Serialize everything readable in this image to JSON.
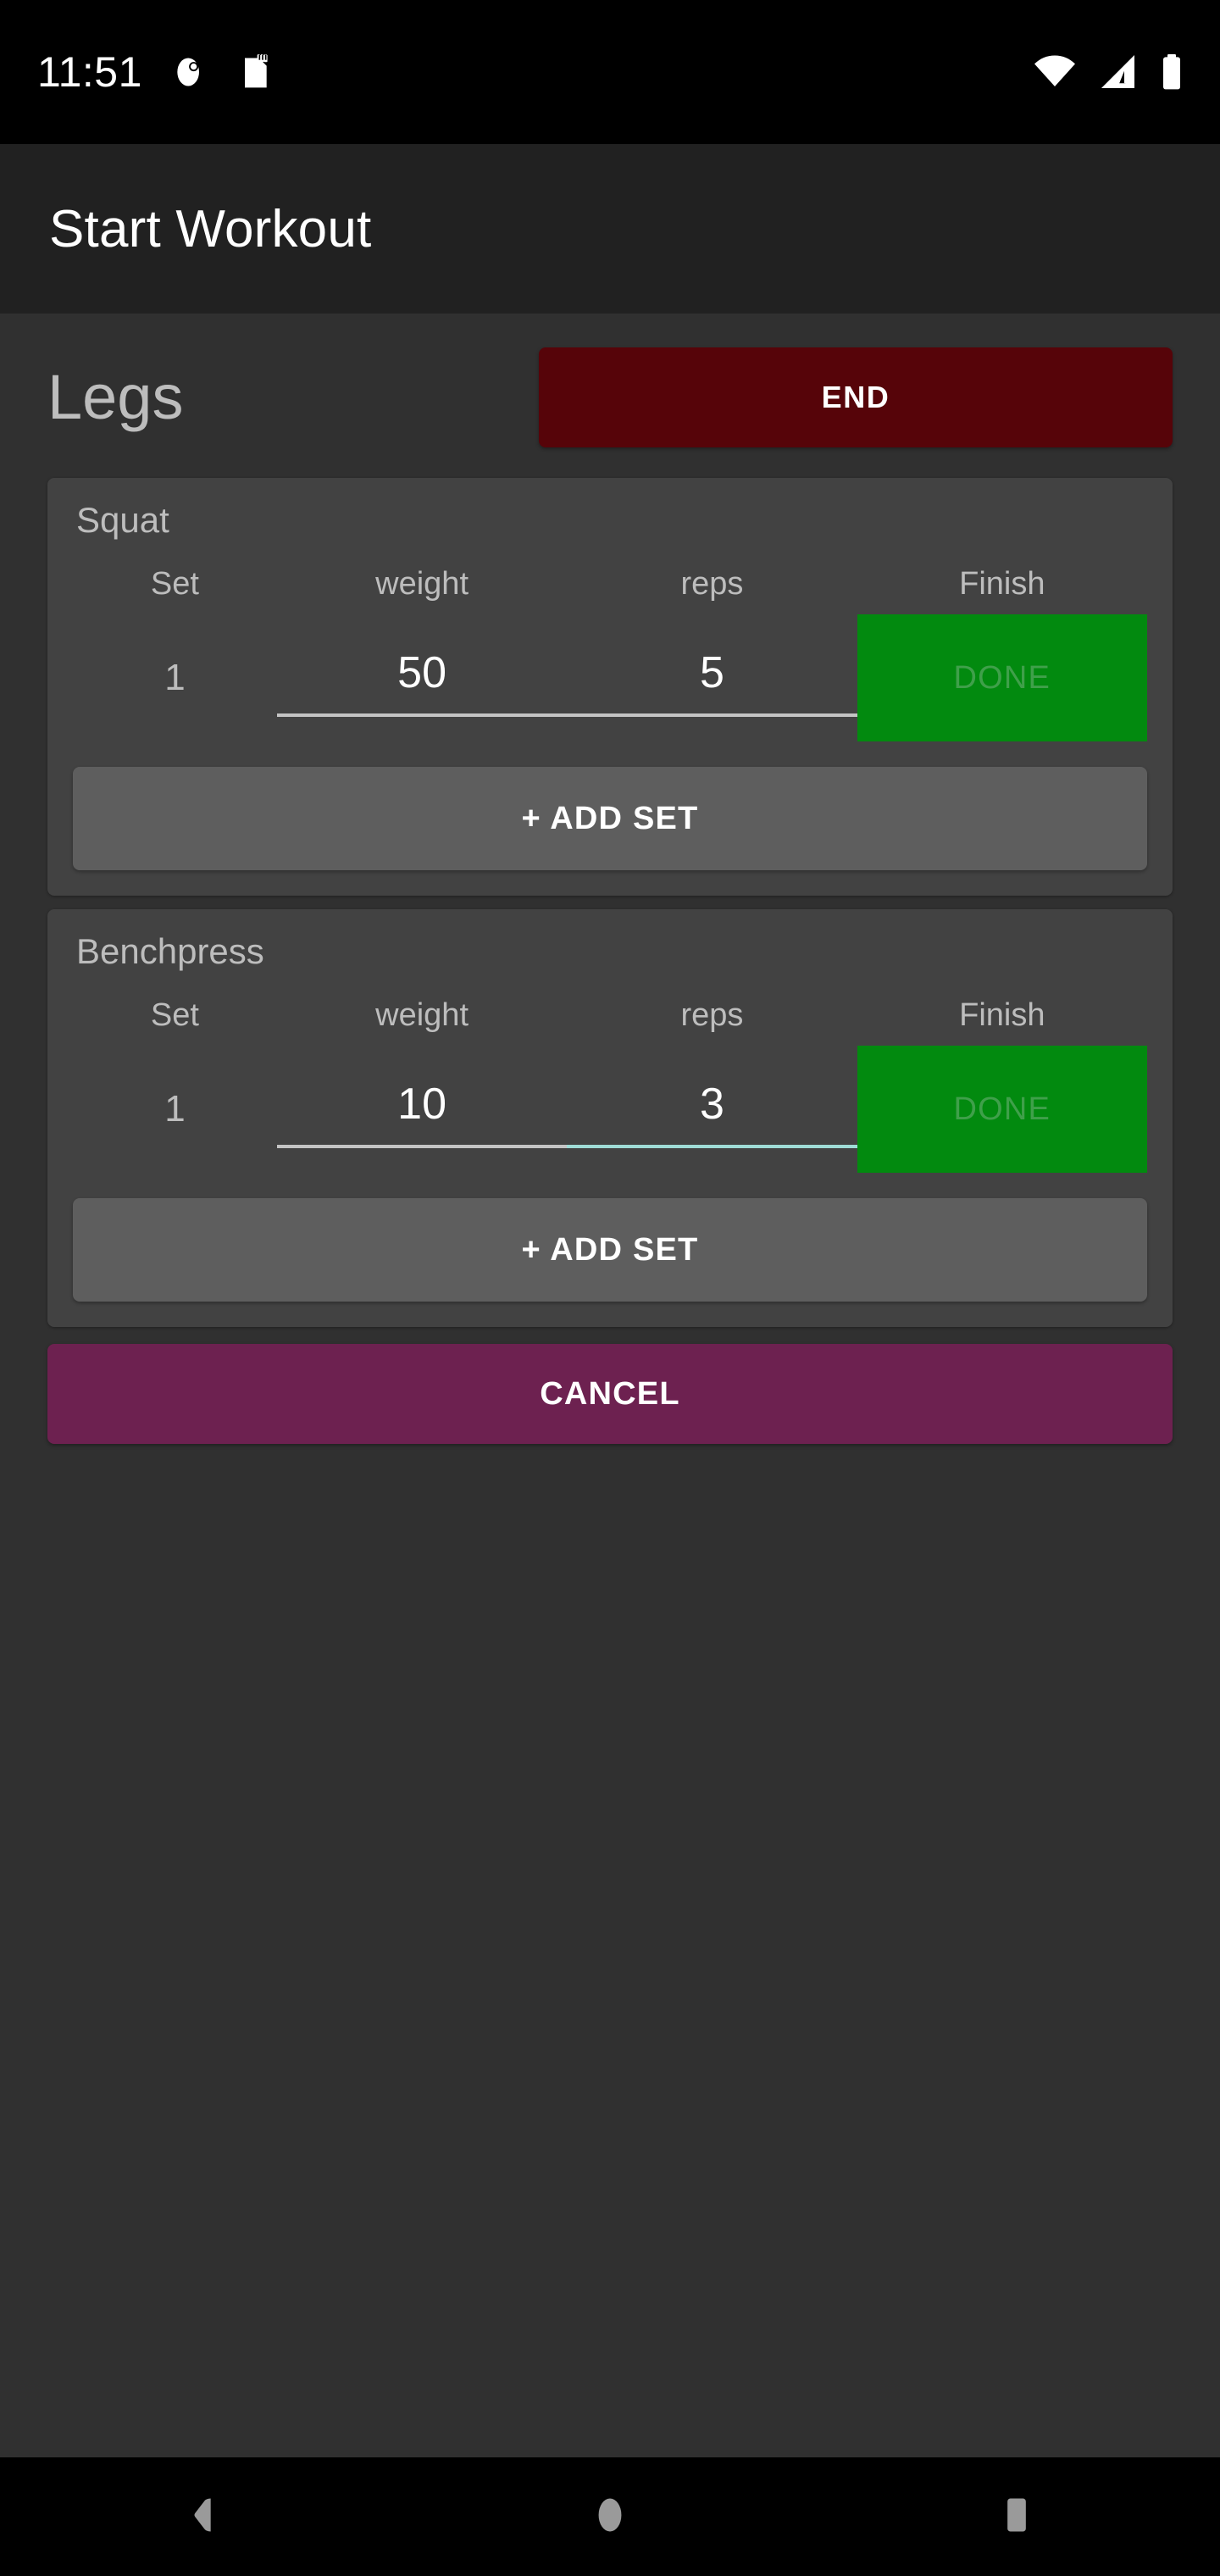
{
  "status_bar": {
    "time": "11:51",
    "left_icons": [
      "clock-alarm-icon",
      "sd-card-icon"
    ],
    "right_icons": [
      "wifi-icon",
      "cellular-signal-icon",
      "battery-icon"
    ]
  },
  "app_bar": {
    "title": "Start Workout"
  },
  "workout": {
    "name": "Legs",
    "end_label": "END",
    "cancel_label": "CANCEL",
    "columns": [
      "Set",
      "weight",
      "reps",
      "Finish"
    ],
    "exercises": [
      {
        "name": "Squat",
        "add_set_label": "+ ADD SET",
        "sets": [
          {
            "set": "1",
            "weight": "50",
            "reps": "5",
            "weight_focused": false,
            "reps_focused": false,
            "done_label": "DONE"
          }
        ]
      },
      {
        "name": "Benchpress",
        "add_set_label": "+ ADD SET",
        "sets": [
          {
            "set": "1",
            "weight": "10",
            "reps": "3",
            "weight_focused": false,
            "reps_focused": true,
            "done_label": "DONE"
          }
        ]
      }
    ]
  },
  "nav_bar": {
    "back_label": "back-icon",
    "home_label": "home-icon",
    "recents_label": "recents-icon"
  },
  "colors": {
    "background": "#303030",
    "app_bar": "#212121",
    "card": "#424242",
    "end_button": "#560409",
    "cancel_button": "#6D2150",
    "done_button": "#028A0F",
    "add_set_button": "#5E5E5E",
    "focus_underline": "#9FDCD6",
    "muted_text": "#BDBDBD"
  }
}
